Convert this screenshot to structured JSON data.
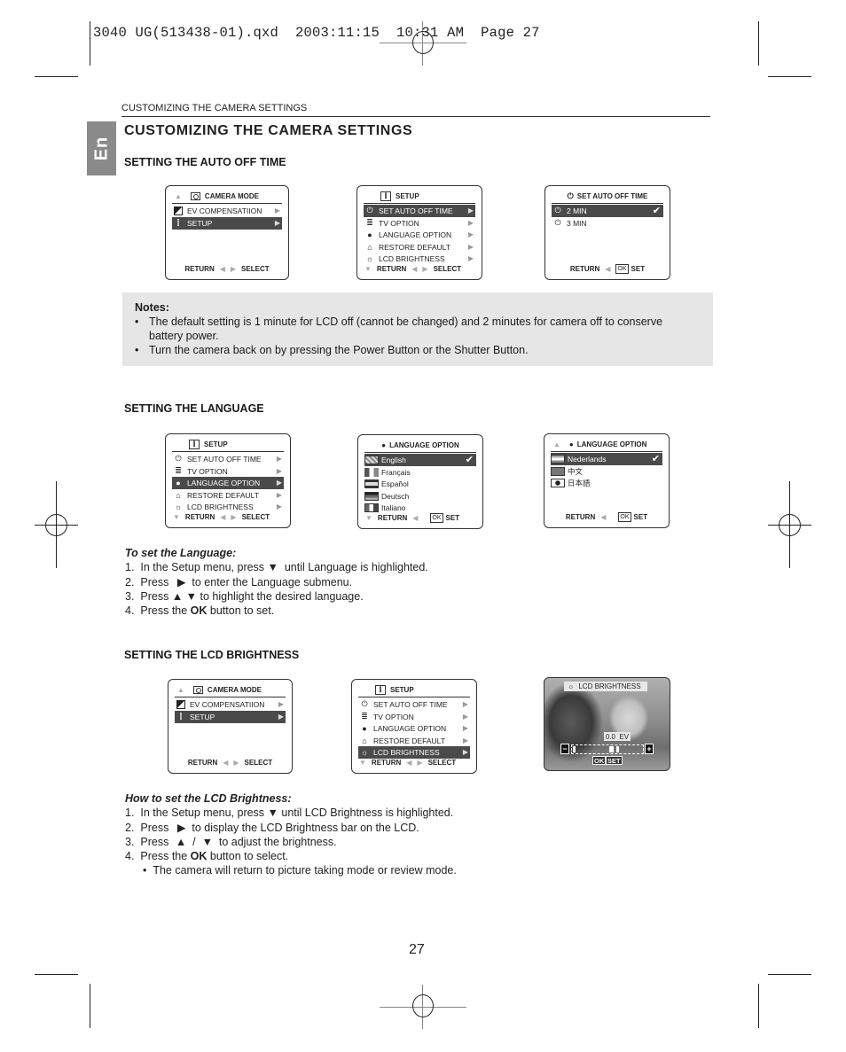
{
  "slug": "3040 UG(513438-01).qxd  2003:11:15  10:31 AM  Page 27",
  "running_head": "CUSTOMIZING THE CAMERA SETTINGS",
  "language_tab": "En",
  "title": "CUSTOMIZING THE CAMERA SETTINGS",
  "sections": {
    "auto_off": {
      "heading": "SETTING THE AUTO OFF TIME",
      "screen1": {
        "title": "CAMERA MODE",
        "items": [
          {
            "label": "EV COMPENSATIION",
            "icon": "ev-icon",
            "selected": false
          },
          {
            "label": "SETUP",
            "icon": "setup-icon",
            "selected": true
          }
        ],
        "footer_left": "RETURN",
        "footer_right": "SELECT"
      },
      "screen2": {
        "title": "SETUP",
        "items": [
          {
            "label": "SET AUTO OFF TIME",
            "icon": "power-icon",
            "selected": true
          },
          {
            "label": "TV OPTION",
            "icon": "tv-icon",
            "selected": false
          },
          {
            "label": "LANGUAGE OPTION",
            "icon": "language-icon",
            "selected": false
          },
          {
            "label": "RESTORE DEFAULT",
            "icon": "restore-icon",
            "selected": false
          },
          {
            "label": "LCD BRIGHTNESS",
            "icon": "brightness-icon",
            "selected": false
          }
        ],
        "footer_left": "RETURN",
        "footer_right": "SELECT"
      },
      "screen3": {
        "title": "SET AUTO OFF TIME",
        "items": [
          {
            "label": "2 MIN",
            "icon": "power-icon",
            "selected": true,
            "checked": true
          },
          {
            "label": "3 MIN",
            "icon": "power-icon",
            "selected": false,
            "checked": false
          }
        ],
        "footer_left": "RETURN",
        "footer_ok": "OK",
        "footer_right": "SET"
      }
    },
    "notes": {
      "title": "Notes:",
      "bullets": [
        "The default setting is 1 minute for LCD off (cannot be changed) and 2 minutes for camera off to conserve battery power.",
        "Turn the camera back on by pressing the Power Button or the Shutter Button."
      ]
    },
    "language": {
      "heading": "SETTING THE LANGUAGE",
      "screen1": {
        "title": "SETUP",
        "items": [
          {
            "label": "SET AUTO OFF TIME",
            "icon": "power-icon",
            "selected": false
          },
          {
            "label": "TV OPTION",
            "icon": "tv-icon",
            "selected": false
          },
          {
            "label": "LANGUAGE OPTION",
            "icon": "language-icon",
            "selected": true
          },
          {
            "label": "RESTORE DEFAULT",
            "icon": "restore-icon",
            "selected": false
          },
          {
            "label": "LCD BRIGHTNESS",
            "icon": "brightness-icon",
            "selected": false
          }
        ],
        "footer_left": "RETURN",
        "footer_right": "SELECT"
      },
      "screen2": {
        "title": "LANGUAGE  OPTION",
        "items": [
          {
            "label": "English",
            "flag": "uk",
            "selected": true,
            "checked": true
          },
          {
            "label": "Français",
            "flag": "fr",
            "selected": false
          },
          {
            "label": "Español",
            "flag": "es",
            "selected": false
          },
          {
            "label": "Deutsch",
            "flag": "de",
            "selected": false
          },
          {
            "label": "Italiano",
            "flag": "it",
            "selected": false
          }
        ],
        "footer_left": "RETURN",
        "footer_ok": "OK",
        "footer_right": "SET"
      },
      "screen3": {
        "title": "LANGUAGE  OPTION",
        "items": [
          {
            "label": "Nederlands",
            "flag": "nl",
            "selected": true,
            "checked": true
          },
          {
            "label": "中文",
            "flag": "cn",
            "selected": false
          },
          {
            "label": "日本語",
            "flag": "jp",
            "selected": false
          }
        ],
        "footer_left": "RETURN",
        "footer_ok": "OK",
        "footer_right": "SET"
      },
      "steps_title": "To set the Language:",
      "steps": [
        {
          "num": "1.",
          "pre": "In the Setup menu, press ",
          "sym": "▼",
          "post": "  until Language is highlighted."
        },
        {
          "num": "2.",
          "pre": "Press ",
          "sym": "▶",
          "post": "  to enter the Language submenu."
        },
        {
          "num": "3.",
          "pre": "Press ",
          "sym": "▲ ▼",
          "post": " to highlight the desired language."
        },
        {
          "num": "4.",
          "pre": "Press the ",
          "bold": "OK",
          "post": " button to set."
        }
      ]
    },
    "brightness": {
      "heading": "SETTING THE LCD BRIGHTNESS",
      "screen1": {
        "title": "CAMERA MODE",
        "items": [
          {
            "label": "EV COMPENSATIION",
            "icon": "ev-icon",
            "selected": false
          },
          {
            "label": "SETUP",
            "icon": "setup-icon",
            "selected": true
          }
        ],
        "footer_left": "RETURN",
        "footer_right": "SELECT"
      },
      "screen2": {
        "title": "SETUP",
        "items": [
          {
            "label": "SET AUTO OFF TIME",
            "icon": "power-icon",
            "selected": false
          },
          {
            "label": "TV OPTION",
            "icon": "tv-icon",
            "selected": false
          },
          {
            "label": "LANGUAGE OPTION",
            "icon": "language-icon",
            "selected": false
          },
          {
            "label": "RESTORE DEFAULT",
            "icon": "restore-icon",
            "selected": false
          },
          {
            "label": "LCD BRIGHTNESS",
            "icon": "brightness-icon",
            "selected": true
          }
        ],
        "footer_left": "RETURN",
        "footer_right": "SELECT"
      },
      "screen3": {
        "title": "LCD BRIGHTNESS",
        "ev_value": "0.0  EV",
        "level": 0.5,
        "minus": "−",
        "plus": "+",
        "ok": "OK",
        "set": "SET"
      },
      "steps_title": "How to set the LCD Brightness:",
      "steps": [
        {
          "num": "1.",
          "pre": "In the Setup menu, press ",
          "sym": "▼",
          "post": " until LCD Brightness is highlighted."
        },
        {
          "num": "2.",
          "pre": "Press ",
          "sym": "▶",
          "post": "  to display the LCD Brightness bar on the LCD."
        },
        {
          "num": "3.",
          "pre": "Press ",
          "sym": "▲  /  ▼",
          "post": "  to adjust the brightness."
        },
        {
          "num": "4.",
          "pre": "Press the ",
          "bold": "OK",
          "post": " button to select."
        }
      ],
      "sub_bullet": "The camera will return to picture taking mode or review mode."
    }
  },
  "page_number": "27"
}
